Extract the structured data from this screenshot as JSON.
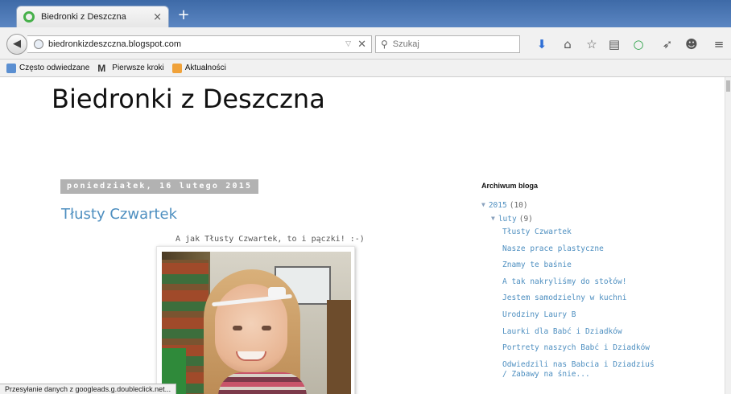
{
  "browser": {
    "tab": {
      "title": "Biedronki z Deszczna",
      "close": "×"
    },
    "new_tab": "+",
    "url": "biedronkizdeszczna.blogspot.com",
    "url_dropdown": "▽",
    "url_stop": "✕",
    "search": {
      "placeholder": "Szukaj"
    },
    "toolbar_icons": [
      "download-icon",
      "home-icon",
      "bookmark-star-icon",
      "reading-list-icon",
      "green-circle-icon",
      "send-icon",
      "chat-icon",
      "menu-icon"
    ],
    "bookmarks": [
      {
        "label": "Często odwiedzane",
        "icon": "star"
      },
      {
        "label": "Pierwsze kroki",
        "icon": "m"
      },
      {
        "label": "Aktualności",
        "icon": "rss"
      }
    ],
    "status": "Przesyłanie danych z googleads.g.doubleclick.net..."
  },
  "page": {
    "blog_title": "Biedronki z Deszczna",
    "post": {
      "date": "poniedziałek, 16 lutego 2015",
      "title": "Tłusty Czwartek",
      "body": "A jak Tłusty Czwartek, to i pączki! :-)"
    },
    "sidebar": {
      "heading": "Archiwum bloga",
      "year": {
        "label": "2015",
        "count": "(10)"
      },
      "month": {
        "label": "luty",
        "count": "(9)"
      },
      "posts": [
        "Tłusty Czwartek",
        "Nasze prace plastyczne",
        "Znamy te baśnie",
        "A tak nakryliśmy do stołów!",
        "Jestem samodzielny w kuchni",
        "Urodziny Laury B",
        "Laurki dla Babć i Dziadków",
        "Portrety naszych Babć i Dziadków",
        "Odwiedzili nas Babcia i Dziadziuś / Zabawy na śnie..."
      ]
    }
  },
  "colors": {
    "link": "#4e8fc0",
    "date_header_bg": "#b2b2b2",
    "tabbar": "#3e6aa7"
  }
}
